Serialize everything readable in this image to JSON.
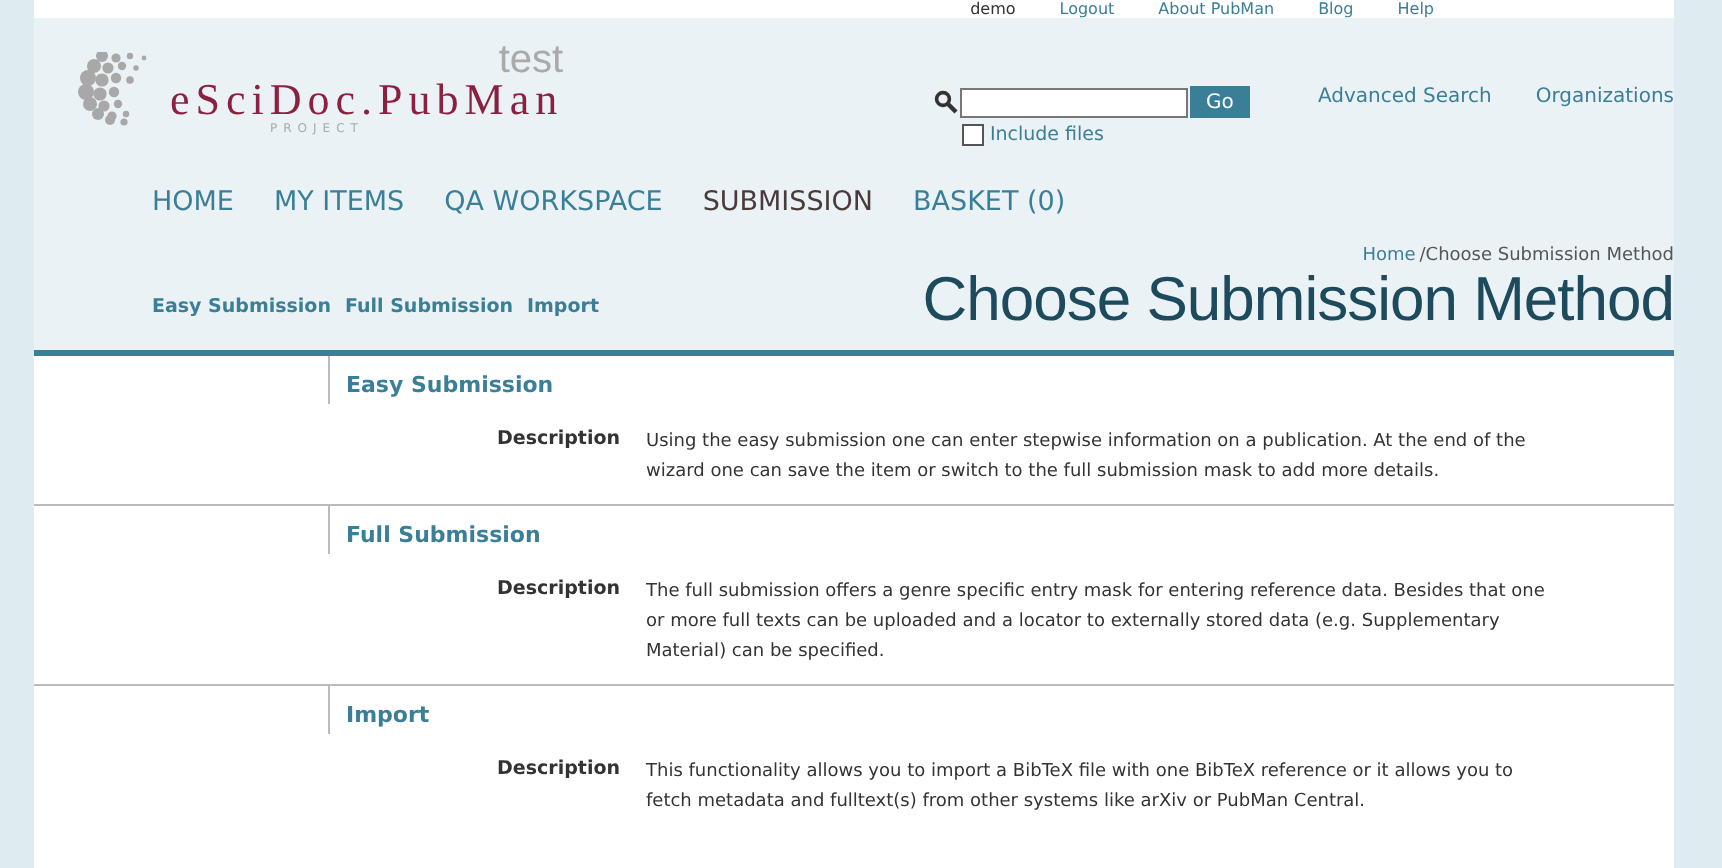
{
  "top_links": [
    {
      "label": "demo",
      "kind": "text"
    },
    {
      "label": "Logout",
      "kind": "link"
    },
    {
      "label": "About PubMan",
      "kind": "link"
    },
    {
      "label": "Blog",
      "kind": "link"
    },
    {
      "label": "Help",
      "kind": "link"
    }
  ],
  "logo": {
    "name": "eSciDoc.PubMan",
    "sub": "PROJECT",
    "badge": "test"
  },
  "search": {
    "button": "Go",
    "include_files": {
      "label": "Include files",
      "checked": false
    }
  },
  "header_links": [
    "Advanced Search",
    "Organizations"
  ],
  "main_nav": [
    {
      "label": "HOME",
      "selected": false
    },
    {
      "label": "MY ITEMS",
      "selected": false
    },
    {
      "label": "QA WORKSPACE",
      "selected": false
    },
    {
      "label": "SUBMISSION",
      "selected": true
    },
    {
      "label": "BASKET (0)",
      "selected": false
    }
  ],
  "sub_nav": [
    "Easy Submission",
    "Full Submission",
    "Import"
  ],
  "breadcrumb": {
    "link": "Home",
    "current": "/Choose Submission Method"
  },
  "page_title": "Choose Submission Method",
  "sections": [
    {
      "title": "Easy Submission",
      "label": "Description",
      "text": "Using the easy submission one can enter stepwise information on a publication. At the end of the wizard one can save the item or switch to the full submission mask to add more details."
    },
    {
      "title": "Full Submission",
      "label": "Description",
      "text": "The full submission offers a genre specific entry mask for entering reference data. Besides that one or more full texts can be uploaded and a locator to externally stored data (e.g. Supplementary Material) can be specified."
    },
    {
      "title": "Import",
      "label": "Description",
      "text": "This functionality allows you to import a BibTeX file with one BibTeX reference or it allows you to fetch metadata and fulltext(s) from other systems like arXiv or PubMan Central."
    }
  ]
}
